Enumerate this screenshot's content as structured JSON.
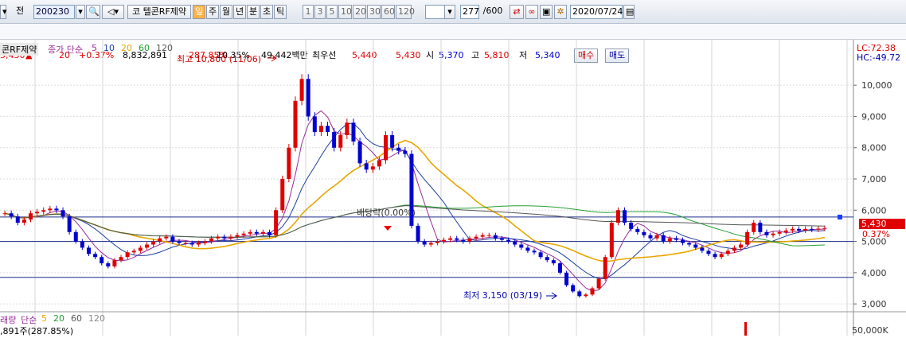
{
  "toolbar": {
    "prev_label": "전",
    "code_value": "200230",
    "stock_name": "코 텔콘RF제약",
    "periods": [
      "일",
      "주",
      "월",
      "년",
      "분",
      "초",
      "틱"
    ],
    "selected_period": "일",
    "intervals": [
      "1",
      "3",
      "5",
      "10",
      "20",
      "30",
      "60",
      "120"
    ],
    "count_value": "277",
    "count_total": "/600",
    "date_value": "2020/07/24"
  },
  "quote": {
    "price": "5,430",
    "change_arrow": "▲",
    "change": "20",
    "change_pct": "+0.37%",
    "volume": "8,832,891",
    "vol_ratio": "287.85%",
    "turnover": "10.35%",
    "amount": "49,442백만",
    "best_label": "최우선",
    "best_ask": "5,440",
    "best_bid": "5,430",
    "open_label": "시",
    "open": "5,370",
    "high_label": "고",
    "high": "5,810",
    "low_label": "저",
    "low": "5,340",
    "buy_button": "매수",
    "sell_button": "매도"
  },
  "legend": {
    "stock": "콘RF제약",
    "ma_title": "종가 단순",
    "ma_periods": [
      "5",
      "10",
      "20",
      "60",
      "120"
    ],
    "vol_title": "래량",
    "vol_type": "단순",
    "vol_periods": [
      "5",
      "20",
      "60",
      "120"
    ],
    "vol_value": ",891주(287.85%)"
  },
  "annotations": {
    "high_note": "최고 10,800 (11/06)",
    "low_note": "최저 3,150 (03/19)",
    "dividend": "배당락(0.00%)",
    "lc": "LC:72.38",
    "hc": "HC:-49.72",
    "price_tag": "5,430",
    "pct_tag": "0.37%"
  },
  "colors": {
    "up": "#e00000",
    "down": "#0000d0",
    "ma5": "#9b2d9b",
    "ma10": "#1d3fa0",
    "ma20": "#e8a600",
    "ma60": "#22a030",
    "ma120": "#555555"
  },
  "chart_data": {
    "type": "candlestick",
    "y_ticks": [
      "10,000",
      "9,000",
      "8,000",
      "7,000",
      "6,000",
      "5,000",
      "4,000",
      "3,000"
    ],
    "y_range": [
      2800,
      11200
    ],
    "vol_ticks": [
      "50,000K"
    ],
    "closes": [
      5900,
      5800,
      5600,
      5700,
      5900,
      5950,
      6000,
      6050,
      6000,
      5800,
      5300,
      5000,
      4800,
      4600,
      4500,
      4300,
      4200,
      4400,
      4500,
      4650,
      4700,
      4800,
      4900,
      5000,
      5100,
      5150,
      5000,
      4950,
      4950,
      4900,
      4950,
      5000,
      5100,
      5150,
      5100,
      5150,
      5200,
      5250,
      5300,
      5250,
      5300,
      5200,
      6000,
      7000,
      8000,
      9500,
      10200,
      9000,
      8500,
      8700,
      8500,
      8000,
      8400,
      8800,
      8200,
      7500,
      7300,
      7400,
      7600,
      8400,
      8000,
      7900,
      7800,
      5500,
      5000,
      4900,
      4950,
      5000,
      5050,
      5100,
      5050,
      5000,
      5100,
      5150,
      5200,
      5200,
      5100,
      5050,
      5000,
      4900,
      4800,
      4700,
      4650,
      4500,
      4400,
      4300,
      4000,
      3600,
      3400,
      3250,
      3300,
      3500,
      3800,
      4500,
      5600,
      6000,
      5600,
      5400,
      5300,
      5200,
      5100,
      5200,
      5000,
      5100,
      5050,
      4950,
      4900,
      4800,
      4700,
      4600,
      4500,
      4600,
      4700,
      4800,
      4900,
      5300,
      5600,
      5300,
      5200,
      5250,
      5300,
      5350,
      5400,
      5350,
      5400,
      5380,
      5410,
      5430
    ],
    "vol_bars": [
      {
        "x": 935,
        "v": 50000
      }
    ]
  }
}
